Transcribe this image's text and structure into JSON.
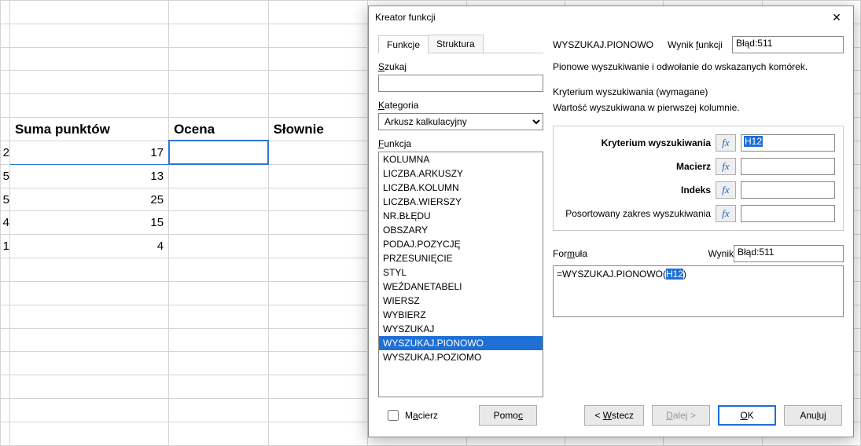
{
  "sheet": {
    "headers": [
      "Suma punktów",
      "Ocena",
      "Słownie"
    ],
    "rows": [
      {
        "partial": "2",
        "sum": "17",
        "grade": "",
        "word": ""
      },
      {
        "partial": "5",
        "sum": "13",
        "grade": "",
        "word": ""
      },
      {
        "partial": "5",
        "sum": "25",
        "grade": "",
        "word": ""
      },
      {
        "partial": "4",
        "sum": "15",
        "grade": "",
        "word": ""
      },
      {
        "partial": "1",
        "sum": "4",
        "grade": "",
        "word": ""
      }
    ]
  },
  "dialog": {
    "title": "Kreator funkcji",
    "close": "✕",
    "tabs": {
      "functions": "Funkcje",
      "structure": "Struktura"
    },
    "search": {
      "label": "Szukaj",
      "value": ""
    },
    "category": {
      "label": "Kategoria",
      "selected": "Arkusz kalkulacyjny"
    },
    "function": {
      "label": "Funkcja",
      "items": [
        "KOLUMNA",
        "LICZBA.ARKUSZY",
        "LICZBA.KOLUMN",
        "LICZBA.WIERSZY",
        "NR.BŁĘDU",
        "OBSZARY",
        "PODAJ.POZYCJĘ",
        "PRZESUNIĘCIE",
        "STYL",
        "WEŹDANETABELI",
        "WIERSZ",
        "WYBIERZ",
        "WYSZUKAJ",
        "WYSZUKAJ.PIONOWO",
        "WYSZUKAJ.POZIOMO"
      ],
      "selected": "WYSZUKAJ.PIONOWO"
    },
    "selected_fn": "WYSZUKAJ.PIONOWO",
    "fn_result_label": "Wynik funkcji",
    "fn_result": "Błąd:511",
    "fn_desc": "Pionowe wyszukiwanie i odwołanie do wskazanych komórek.",
    "crit_head": "Kryterium wyszukiwania (wymagane)",
    "crit_sub": "Wartość wyszukiwana w pierwszej kolumnie.",
    "args": [
      {
        "label": "Kryterium wyszukiwania",
        "bold": true,
        "value": "H12",
        "selected": true
      },
      {
        "label": "Macierz",
        "bold": true,
        "value": ""
      },
      {
        "label": "Indeks",
        "bold": true,
        "value": ""
      },
      {
        "label": "Posortowany zakres wyszukiwania",
        "bold": false,
        "value": ""
      }
    ],
    "fx": "fx",
    "formula": {
      "label": "Formuła",
      "result_label": "Wynik",
      "result": "Błąd:511",
      "pre": "=WYSZUKAJ.PIONOWO(",
      "sel": "H12",
      "post": ")"
    },
    "footer": {
      "matrix": "Macierz",
      "help": "Pomoc",
      "back": "< Wstecz",
      "next": "Dalej >",
      "ok": "OK",
      "cancel": "Anuluj"
    }
  }
}
